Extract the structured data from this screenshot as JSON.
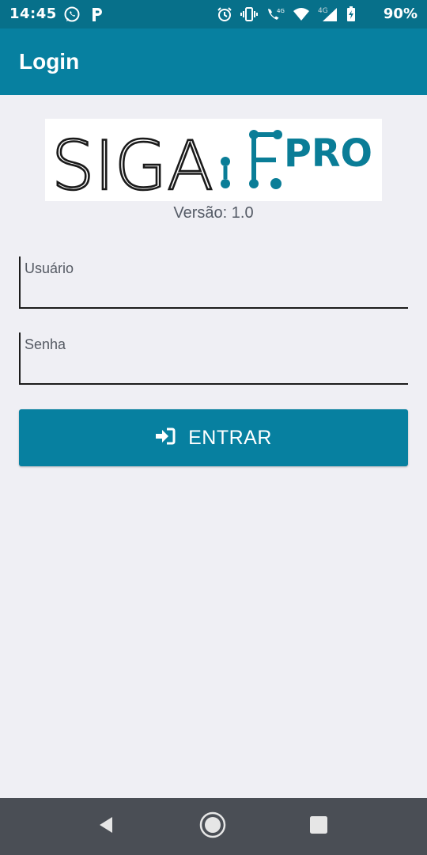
{
  "status_bar": {
    "time": "14:45",
    "battery": "90%",
    "network_label": "4G",
    "icons_left": [
      "whatsapp-icon",
      "parking-icon"
    ],
    "icons_right": [
      "alarm-icon",
      "vibrate-icon",
      "volte-call-icon",
      "wifi-icon",
      "signal-icon",
      "battery-charging-icon"
    ]
  },
  "app_bar": {
    "title": "Login"
  },
  "logo": {
    "text_main": "SIGA",
    "text_pro": "PRO",
    "brand_color": "#0a7d97"
  },
  "version": "Versão: 1.0",
  "form": {
    "username_label": "Usuário",
    "username_value": "",
    "password_label": "Senha",
    "password_value": ""
  },
  "login_button": {
    "label": "ENTRAR",
    "icon": "sign-in-icon"
  },
  "nav_bar": {
    "back": "back-icon",
    "home": "home-icon",
    "recents": "recents-icon"
  },
  "colors": {
    "primary": "#0780a0",
    "status_bar": "#07708a",
    "background": "#efeff4",
    "nav_bar": "#4a4e55"
  }
}
